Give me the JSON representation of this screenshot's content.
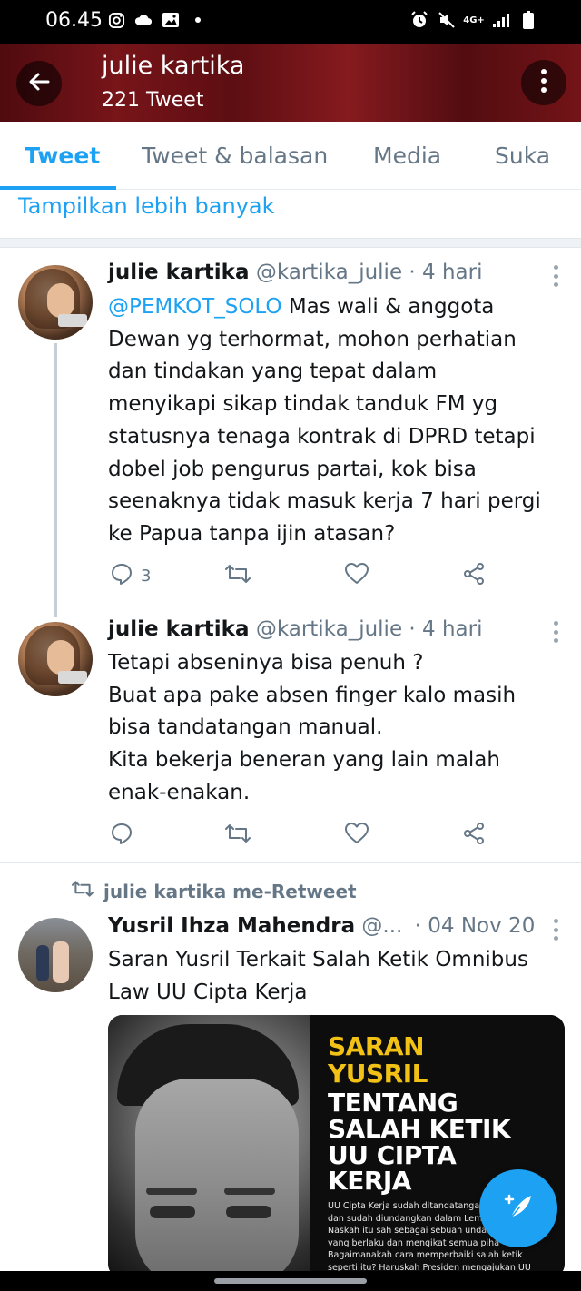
{
  "status_bar": {
    "time": "06.45",
    "network": "4G+"
  },
  "header": {
    "name": "julie kartika",
    "tweet_count": "221 Tweet"
  },
  "tabs": [
    {
      "label": "Tweet",
      "active": true
    },
    {
      "label": "Tweet & balasan",
      "active": false
    },
    {
      "label": "Media",
      "active": false
    },
    {
      "label": "Suka",
      "active": false
    }
  ],
  "show_more": "Tampilkan lebih banyak",
  "tweets": [
    {
      "name": "julie kartika",
      "handle_time": "@kartika_julie · 4 hari",
      "mention": "@PEMKOT_SOLO",
      "text": " Mas wali & anggota\nDewan yg terhormat, mohon perhatian\ndan tindakan yang tepat dalam\nmenyikapi sikap tindak tanduk   FM yg\nstatusnya tenaga kontrak di DPRD tetapi\ndobel job pengurus partai, kok bisa\nseenaknya tidak masuk kerja 7 hari pergi\nke Papua tanpa ijin atasan?",
      "reply_count": "3"
    },
    {
      "name": "julie kartika",
      "handle_time": "@kartika_julie · 4 hari",
      "text": "Tetapi abseninya bisa penuh ?\nBuat apa pake absen finger kalo masih\nbisa tandatangan manual.\nKita bekerja beneran yang lain malah\nenak-enakan."
    }
  ],
  "retweet": {
    "label": "julie kartika me-Retweet",
    "name": "Yusril Ihza Mahendra",
    "handle": "@...",
    "date": "· 04 Nov 20",
    "text": "Saran Yusril Terkait Salah Ketik Omnibus\nLaw UU Cipta Kerja",
    "image": {
      "headline_yellow_1": "SARAN",
      "headline_yellow_2": "YUSRIL",
      "headline_white_1": "TENTANG",
      "headline_white_2": "SALAH KETIK",
      "headline_white_3": "UU CIPTA",
      "headline_white_4": "KERJA",
      "caption": "UU Cipta Kerja sudah ditandatangani\ndan sudah diundangkan dalam Lemba\nNaskah itu sah sebagai sebuah unda\nyang berlaku dan mengikat semua piha\nBagaimanakah cara memperbaiki salah ketik\nseperti itu? Haruskah Presiden mengajukan UU"
    }
  },
  "colors": {
    "accent": "#1da1f2",
    "header_bg": "#8c1a1f",
    "meta": "#657786"
  }
}
